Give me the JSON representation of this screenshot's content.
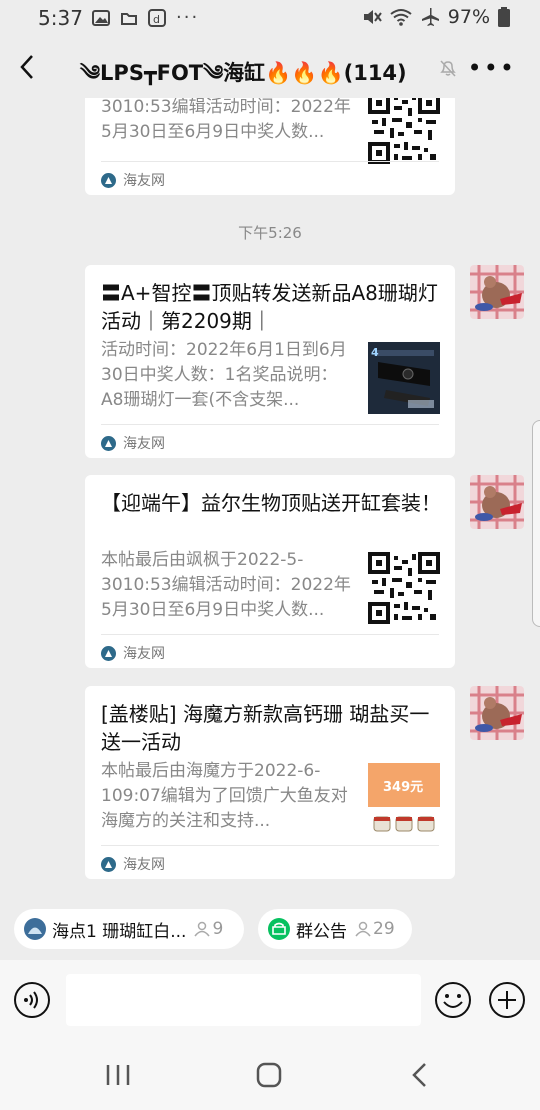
{
  "status": {
    "time": "5:37",
    "battery": "97%"
  },
  "header": {
    "title": "༄LPS┳FOT༄海缸🔥🔥🔥(114)"
  },
  "cards": [
    {
      "desc": "3010:53编辑活动时间：2022年5月30日至6月9日中奖人数...",
      "source": "海友网"
    },
    {
      "title": "〓A+智控〓顶贴转发送新品A8珊瑚灯活动｜第2209期｜",
      "desc": "活动时间：2022年6月1日到6月30日中奖人数：1名奖品说明：A8珊瑚灯一套(不含支架...",
      "source": "海友网"
    },
    {
      "title": "【迎端午】益尔生物顶贴送开缸套装！",
      "desc": "本帖最后由飒枫于2022-5-3010:53编辑活动时间：2022年5月30日至6月9日中奖人数...",
      "source": "海友网"
    },
    {
      "title": "[盖楼贴] 海魔方新款高钙珊 瑚盐买一送一活动",
      "desc": "本帖最后由海魔方于2022-6-109:07编辑为了回馈广大鱼友对海魔方的关注和支持...",
      "source": "海友网",
      "thumb_text": "349元"
    }
  ],
  "timestamp": "下午5:26",
  "chips": [
    {
      "label": "海点1 珊瑚缸白...",
      "count": "9"
    },
    {
      "label": "群公告",
      "count": "29"
    }
  ],
  "colors": {
    "card_bg": "#ffffff",
    "page_bg": "#ededed",
    "accent_green": "#07c160"
  }
}
